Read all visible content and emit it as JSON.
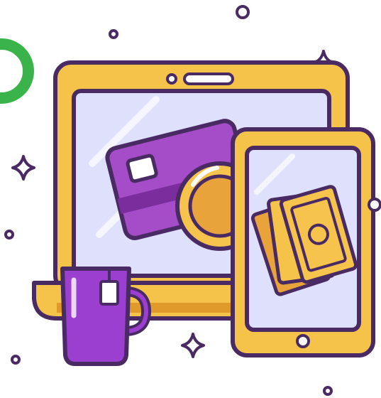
{
  "illustration": {
    "icons": [
      "laptop-icon",
      "credit-card-icon",
      "coin-icon",
      "tablet-icon",
      "banknotes-icon",
      "mug-icon",
      "sparkle-icon",
      "ring-icon"
    ],
    "colors": {
      "outline": "#4a2a63",
      "laptop_body": "#f5c34a",
      "laptop_shadow": "#e09a2a",
      "screen": "#dfe0fb",
      "card": "#a54cc8",
      "card_dark": "#7b2d9e",
      "coin": "#f6c34d",
      "coin_dark": "#e8a43a",
      "banknote": "#f5c34a",
      "mug": "#9b3fd0",
      "ring": "#3ab34a"
    }
  }
}
